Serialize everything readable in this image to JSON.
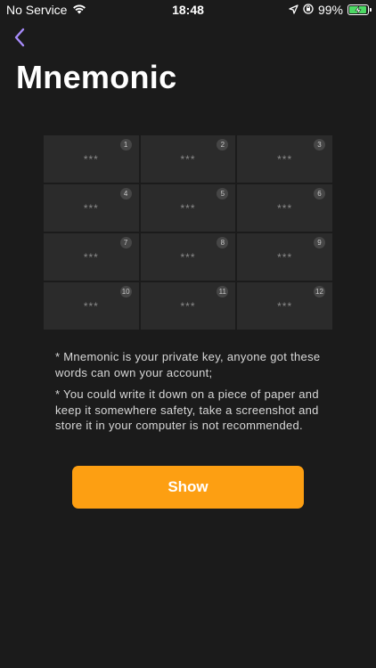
{
  "status_bar": {
    "carrier": "No Service",
    "time": "18:48",
    "battery_percent": "99%",
    "battery_level": 0.99,
    "battery_color": "#4cd964"
  },
  "nav": {
    "back_icon": "chevron-left-icon",
    "back_color": "#a78bfa"
  },
  "page": {
    "title": "Mnemonic"
  },
  "mnemonic_grid": {
    "words": [
      {
        "index": "1",
        "text": "***"
      },
      {
        "index": "2",
        "text": "***"
      },
      {
        "index": "3",
        "text": "***"
      },
      {
        "index": "4",
        "text": "***"
      },
      {
        "index": "5",
        "text": "***"
      },
      {
        "index": "6",
        "text": "***"
      },
      {
        "index": "7",
        "text": "***"
      },
      {
        "index": "8",
        "text": "***"
      },
      {
        "index": "9",
        "text": "***"
      },
      {
        "index": "10",
        "text": "***"
      },
      {
        "index": "11",
        "text": "***"
      },
      {
        "index": "12",
        "text": "***"
      }
    ]
  },
  "notes": [
    "* Mnemonic is your private key, anyone got these words can own your account;",
    "* You could write it down on a piece of paper and keep it somewhere safety, take a screenshot and store it in your computer is not recommended."
  ],
  "actions": {
    "show_label": "Show",
    "show_color": "#fd9f12"
  }
}
